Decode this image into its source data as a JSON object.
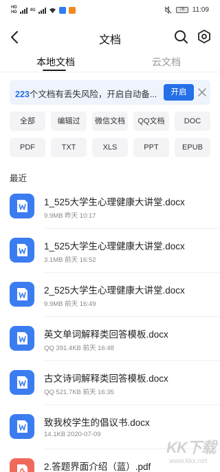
{
  "status_bar": {
    "network_labels": [
      "HD",
      "HD"
    ],
    "signal_label": "4G",
    "battery": "78",
    "time": "11:09"
  },
  "header": {
    "title": "文档",
    "icons": [
      "back-arrow-icon",
      "search-icon",
      "gear-icon"
    ]
  },
  "tabs": [
    {
      "label": "本地文档",
      "active": true
    },
    {
      "label": "云文档",
      "active": false
    }
  ],
  "banner": {
    "count": "223",
    "text": "个文档有丢失风险，开启自动备...",
    "button": "开启"
  },
  "filters": [
    "全部",
    "编辑过",
    "微信文档",
    "QQ文档",
    "DOC",
    "PDF",
    "TXT",
    "XLS",
    "PPT",
    "EPUB"
  ],
  "recent_label": "最近",
  "files": [
    {
      "name": "1_525大学生心理健康大讲堂.docx",
      "meta": "9.9MB  昨天 10:17",
      "type": "word"
    },
    {
      "name": "1_525大学生心理健康大讲堂.docx",
      "meta": "3.1MB  前天 16:52",
      "type": "word"
    },
    {
      "name": "2_525大学生心理健康大讲堂.docx",
      "meta": "9.9MB  前天 16:49",
      "type": "word"
    },
    {
      "name": "英文单词解释类回答模板.docx",
      "meta": "QQ  391.4KB  前天 16:48",
      "type": "word"
    },
    {
      "name": "古文诗词解释类回答模板.docx",
      "meta": "QQ  521.7KB  前天 16:35",
      "type": "word"
    },
    {
      "name": "致我校学生的倡议书.docx",
      "meta": "14.1KB  2020-07-09",
      "type": "word"
    },
    {
      "name": "2.答题界面介绍（蓝）.pdf",
      "meta": "",
      "type": "pdf"
    }
  ],
  "watermark": {
    "text": "KK下载",
    "url": "www.kkx.net"
  },
  "colors": {
    "accent": "#2570e8",
    "word_icon": "#3b7cf0",
    "pdf_icon": "#f06a5c",
    "banner_bg": "#eef3fc",
    "chip_bg": "#f4f4f6"
  }
}
